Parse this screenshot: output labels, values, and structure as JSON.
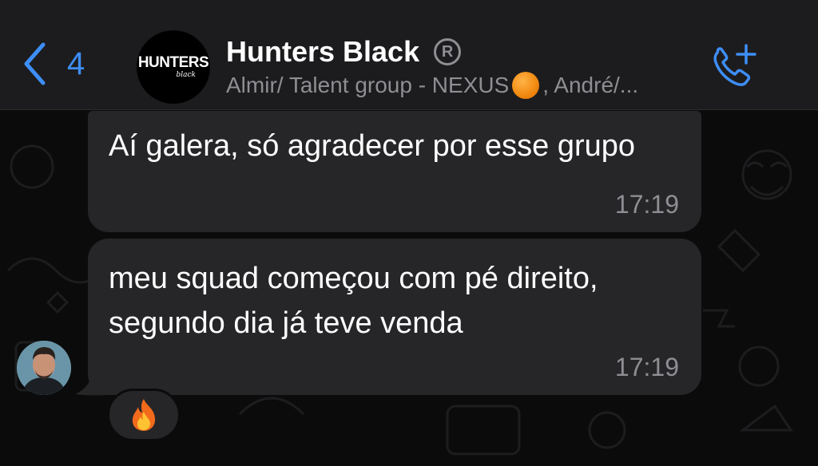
{
  "header": {
    "back_count": "4",
    "group_name": "Hunters Black",
    "registered_mark": "R",
    "subtitle_before": "Almir/ Talent group - NEXUS",
    "subtitle_after": ", André/...",
    "avatar_logo": {
      "main": "HUNTERS",
      "sub": "black"
    },
    "accent_color": "#3e8ef7"
  },
  "messages": [
    {
      "text": "Aí galera, só agradecer por esse grupo",
      "time": "17:19"
    },
    {
      "text": "meu squad começou com pé direito, segundo dia já teve venda",
      "time": "17:19"
    }
  ],
  "reaction": {
    "emoji_icon": "fire-icon"
  },
  "icons": [
    "chevron-left-icon",
    "registered-icon",
    "orange-circle-emoji",
    "add-call-icon",
    "fire-icon"
  ]
}
